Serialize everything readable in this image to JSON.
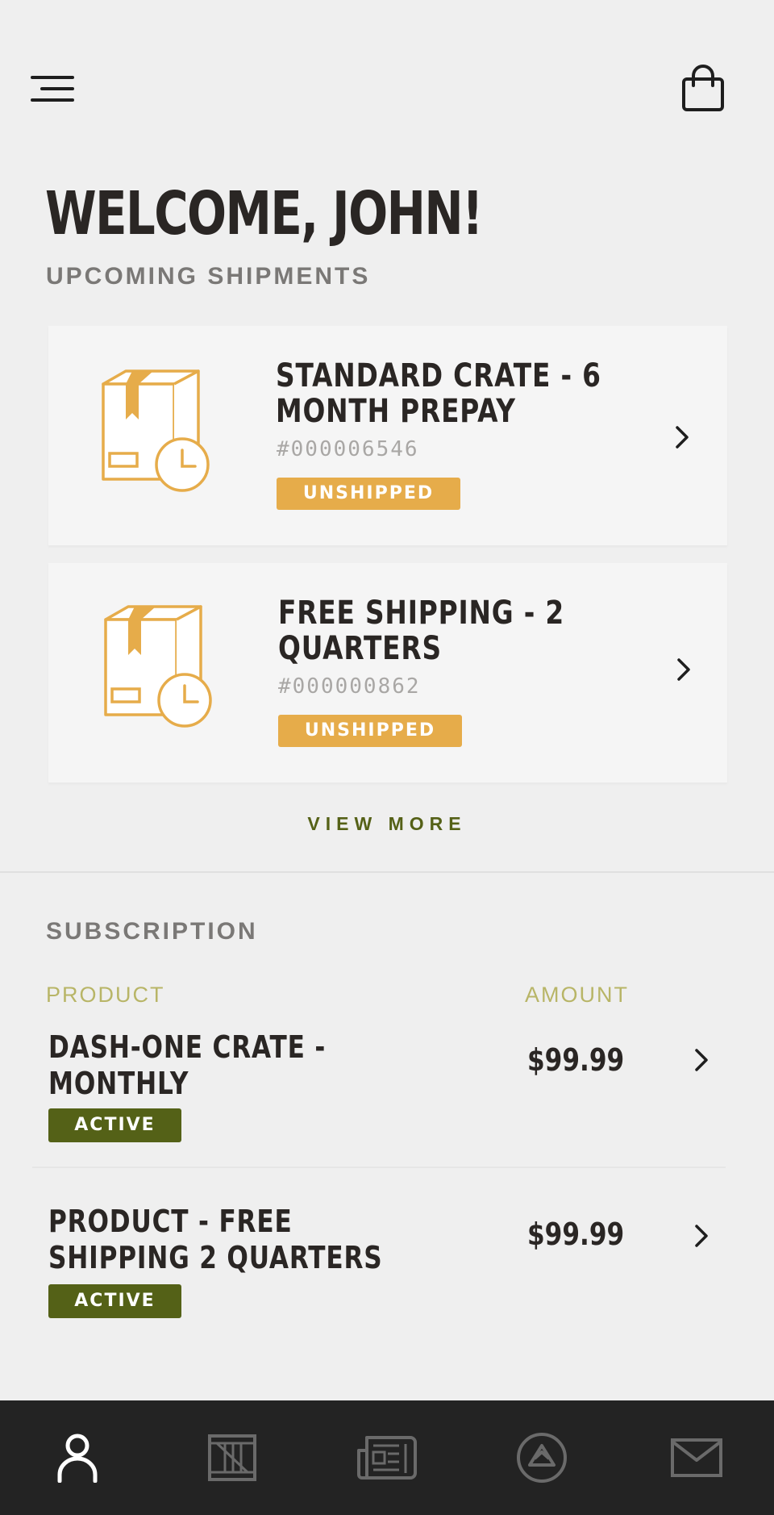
{
  "header": {
    "menu_icon": "menu-icon",
    "cart_icon": "shopping-bag-icon"
  },
  "welcome": {
    "title": "WELCOME, JOHN!"
  },
  "upcoming": {
    "label": "UPCOMING SHIPMENTS",
    "shipments": [
      {
        "title": "STANDARD CRATE - 6 MONTH PREPAY",
        "number": "#000006546",
        "status": "UNSHIPPED"
      },
      {
        "title": "FREE SHIPPING - 2 QUARTERS",
        "number": "#000000862",
        "status": "UNSHIPPED"
      }
    ],
    "view_more": "VIEW MORE"
  },
  "subscription": {
    "label": "SUBSCRIPTION",
    "col_product": "PRODUCT",
    "col_amount": "AMOUNT",
    "items": [
      {
        "name": "DASH-ONE CRATE - MONTHLY",
        "amount": "$99.99",
        "status": "ACTIVE"
      },
      {
        "name": "PRODUCT - FREE SHIPPING 2 QUARTERS",
        "amount": "$99.99",
        "status": "ACTIVE"
      }
    ]
  },
  "bottom_nav": {
    "items": [
      {
        "icon": "user-icon",
        "active": true
      },
      {
        "icon": "crate-icon",
        "active": false
      },
      {
        "icon": "news-icon",
        "active": false
      },
      {
        "icon": "badge-icon",
        "active": false
      },
      {
        "icon": "mail-icon",
        "active": false
      }
    ]
  },
  "colors": {
    "accent_gold": "#e6ac4a",
    "accent_olive": "#546117",
    "nav_bg": "#232323"
  }
}
